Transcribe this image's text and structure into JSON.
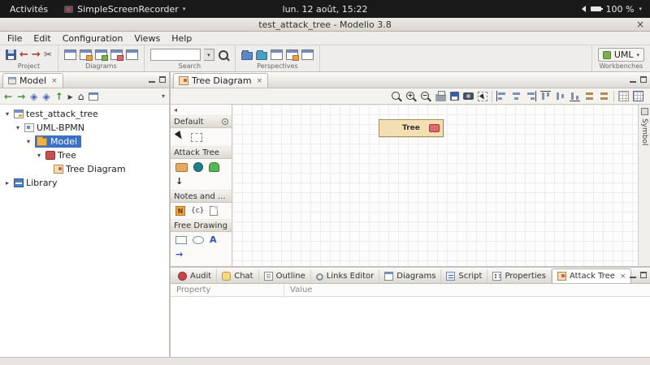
{
  "desktop": {
    "activities": "Activités",
    "app_name": "SimpleScreenRecorder",
    "clock": "lun. 12 août, 15:22",
    "battery": "100 %"
  },
  "window": {
    "title": "test_attack_tree - Modelio 3.8"
  },
  "menus": [
    {
      "label": "File"
    },
    {
      "label": "Edit"
    },
    {
      "label": "Configuration"
    },
    {
      "label": "Views"
    },
    {
      "label": "Help"
    }
  ],
  "toolbar": {
    "groups": {
      "project": "Project",
      "diagrams": "Diagrams",
      "search": "Search",
      "perspectives": "Perspectives",
      "workbenches": "Workbenches"
    },
    "search_value": "",
    "workbench": "UML"
  },
  "model_panel": {
    "tab": "Model",
    "tree": [
      {
        "label": "test_attack_tree"
      },
      {
        "label": "UML-BPMN"
      },
      {
        "label": "Model"
      },
      {
        "label": "Tree"
      },
      {
        "label": "Tree Diagram"
      },
      {
        "label": "Library"
      }
    ]
  },
  "diagram": {
    "tab": "Tree Diagram",
    "palette": {
      "sections": [
        {
          "label": "Default"
        },
        {
          "label": "Attack Tree"
        },
        {
          "label": "Notes and ..."
        },
        {
          "label": "Free Drawing"
        }
      ],
      "note_label": "N",
      "constraint_label": "{c}",
      "text_label": "A"
    },
    "node_label": "Tree",
    "symbol_tab": "Symbol"
  },
  "bottom_panel": {
    "tabs": [
      {
        "label": "Audit"
      },
      {
        "label": "Chat"
      },
      {
        "label": "Outline"
      },
      {
        "label": "Links Editor"
      },
      {
        "label": "Diagrams"
      },
      {
        "label": "Script"
      },
      {
        "label": "Properties"
      },
      {
        "label": "Attack Tree"
      }
    ],
    "active_tab": "Attack Tree",
    "columns": [
      {
        "label": "Property"
      },
      {
        "label": "Value"
      }
    ]
  },
  "glyphs": {
    "caret_down": "▾",
    "caret_right": "▸",
    "close": "×",
    "back": "←",
    "forward": "→",
    "up": "↑",
    "down": "↓",
    "home": "⌂",
    "diamond": "◈",
    "scissors": "✂",
    "plus": "+",
    "minus": "−",
    "left_small": "◂",
    "arrow_right": "→"
  },
  "colors": {
    "selection": "#3d6fc4",
    "node_fill": "#f4deb4",
    "node_border": "#ab8c55",
    "attack_red": "#e06a6a"
  }
}
